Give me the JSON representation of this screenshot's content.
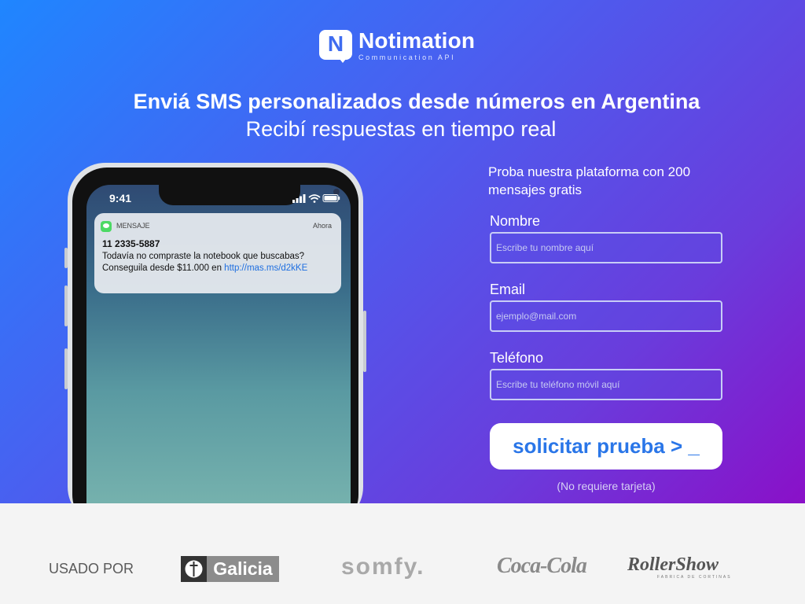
{
  "brand": {
    "logo_letter": "N",
    "name": "Notimation",
    "tagline": "Communication API"
  },
  "hero": {
    "headline": "Enviá SMS personalizados desde números en Argentina",
    "subheadline": "Recibí respuestas en tiempo real"
  },
  "phone": {
    "time": "9:41",
    "notification": {
      "app_name": "MENSAJE",
      "when": "Ahora",
      "sender": "11 2335-5887",
      "line1": "Todavía no compraste la notebook que buscabas?",
      "line2_prefix": "Conseguila desde $11.000 en ",
      "link": "http://mas.ms/d2kKE"
    }
  },
  "form": {
    "intro": "Proba nuestra plataforma con 200 mensajes gratis",
    "name_label": "Nombre",
    "name_placeholder": "Escribe tu nombre aquí",
    "email_label": "Email",
    "email_placeholder": "ejemplo@mail.com",
    "phone_label": "Teléfono",
    "phone_placeholder": "Escribe tu teléfono móvil aquí",
    "submit_label": "solicitar prueba > _",
    "note": "(No requiere tarjeta)"
  },
  "clients": {
    "label": "USADO POR",
    "logos": [
      "Galicia",
      "somfy.",
      "Coca-Cola",
      "RollerShow"
    ],
    "rollershow_sub": "FABRICA DE CORTINAS"
  },
  "colors": {
    "gradient_start": "#1f86ff",
    "gradient_end": "#8a10c8",
    "cta_text": "#2a76e8",
    "footer_bg": "#f4f4f4"
  }
}
